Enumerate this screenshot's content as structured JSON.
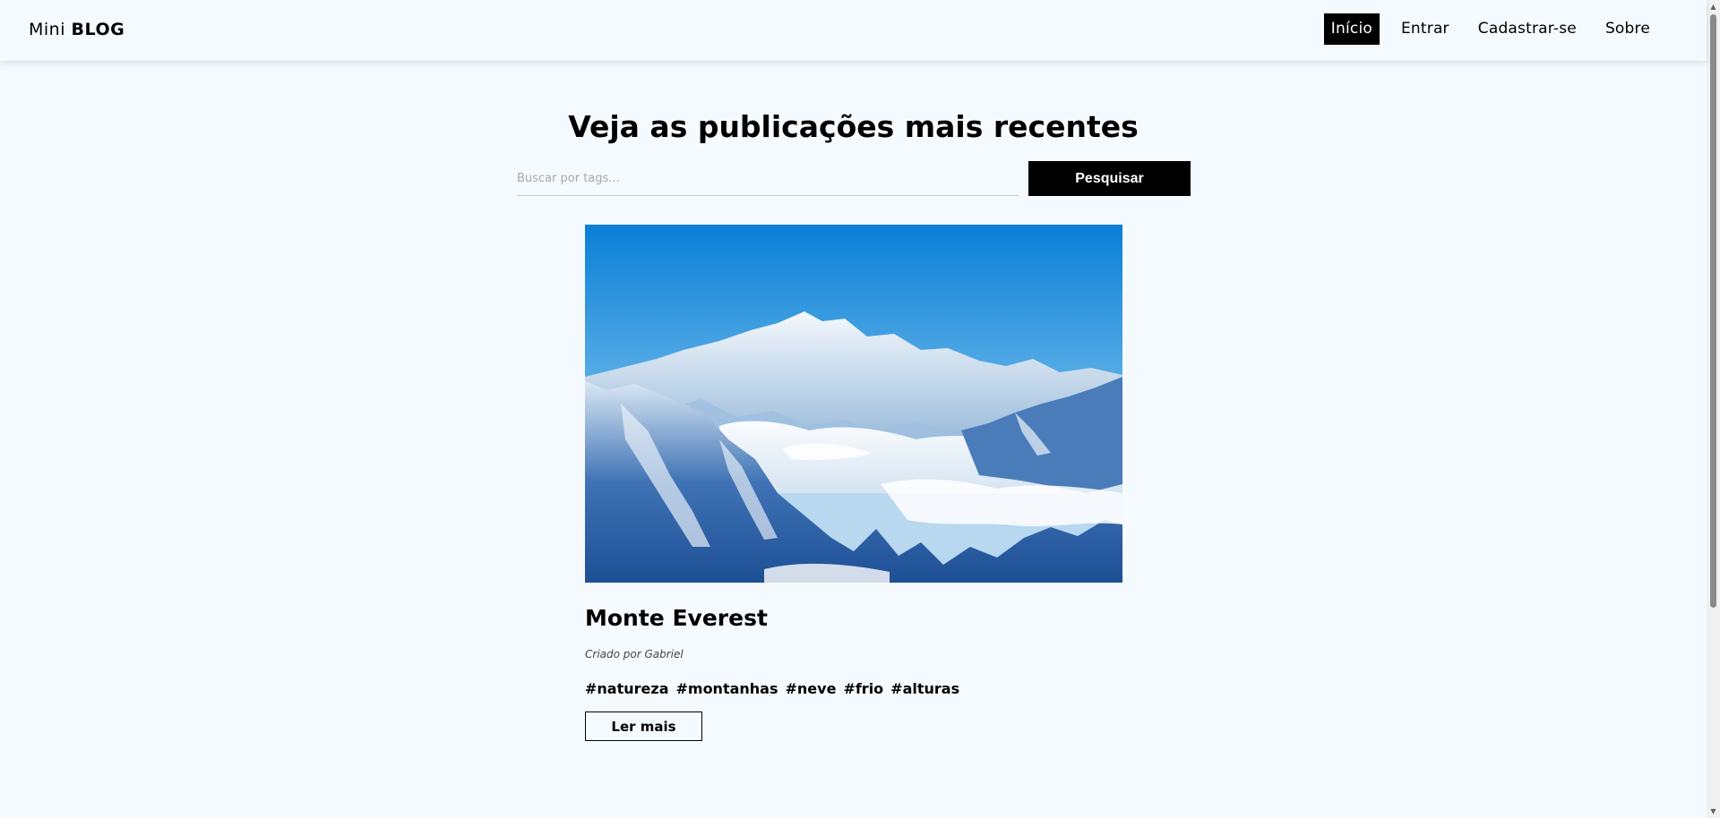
{
  "navbar": {
    "brand_light": "Mini",
    "brand_bold": "BLOG",
    "links": [
      {
        "label": "Início",
        "active": true
      },
      {
        "label": "Entrar"
      },
      {
        "label": "Cadastrar-se"
      },
      {
        "label": "Sobre"
      }
    ]
  },
  "main": {
    "heading": "Veja as publicações mais recentes",
    "search": {
      "placeholder": "Buscar por tags...",
      "button_label": "Pesquisar"
    }
  },
  "post": {
    "title": "Monte Everest",
    "author": "Criado por Gabriel",
    "tags": [
      "#natureza",
      "#montanhas",
      "#neve",
      "#frio",
      "#alturas"
    ],
    "read_more_label": "Ler mais",
    "image_alt": "Monte Everest"
  },
  "colors": {
    "background": "#f5faff",
    "accent": "#000000",
    "sky": "#0a7fd6"
  },
  "icons": [
    "scroll-up-arrow-icon",
    "scroll-down-arrow-icon"
  ]
}
